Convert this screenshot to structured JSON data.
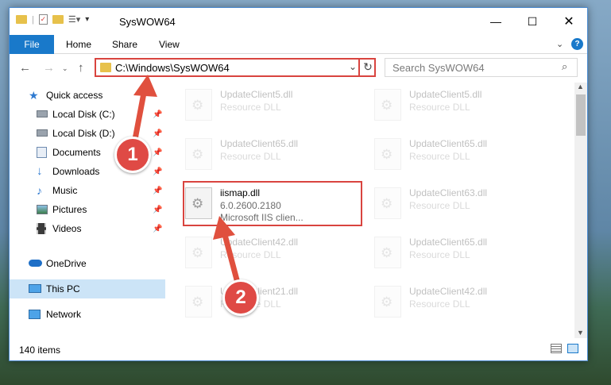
{
  "window": {
    "title": "SysWOW64"
  },
  "ribbon": {
    "tabs": [
      "File",
      "Home",
      "Share",
      "View"
    ]
  },
  "address": {
    "path": "C:\\Windows\\SysWOW64"
  },
  "search": {
    "placeholder": "Search SysWOW64"
  },
  "sidebar": {
    "items": [
      {
        "label": "Quick access",
        "icon": "star-icon",
        "pinned": false
      },
      {
        "label": "Local Disk (C:)",
        "icon": "drive-icon",
        "pinned": true
      },
      {
        "label": "Local Disk (D:)",
        "icon": "drive-icon",
        "pinned": true
      },
      {
        "label": "Documents",
        "icon": "documents-icon",
        "pinned": true
      },
      {
        "label": "Downloads",
        "icon": "download-icon",
        "pinned": true
      },
      {
        "label": "Music",
        "icon": "music-icon",
        "pinned": true
      },
      {
        "label": "Pictures",
        "icon": "pictures-icon",
        "pinned": true
      },
      {
        "label": "Videos",
        "icon": "videos-icon",
        "pinned": true
      },
      {
        "label": "OneDrive",
        "icon": "cloud-icon",
        "pinned": false
      },
      {
        "label": "This PC",
        "icon": "pc-icon",
        "pinned": false,
        "selected": true
      },
      {
        "label": "Network",
        "icon": "network-icon",
        "pinned": false
      }
    ]
  },
  "files": [
    {
      "name": "UpdateClient5.dll",
      "sub": "Resource DLL",
      "faded": true
    },
    {
      "name": "UpdateClient5.dll",
      "sub": "Resource DLL",
      "faded": true
    },
    {
      "name": "UpdateClient65.dll",
      "sub": "Resource DLL",
      "faded": true
    },
    {
      "name": "UpdateClient65.dll",
      "sub": "Resource DLL",
      "faded": true
    },
    {
      "name": "iismap.dll",
      "sub": "6.0.2600.2180",
      "desc": "Microsoft IIS clien...",
      "faded": false
    },
    {
      "name": "UpdateClient63.dll",
      "sub": "Resource DLL",
      "faded": true
    },
    {
      "name": "UpdateClient42.dll",
      "sub": "Resource DLL",
      "faded": true
    },
    {
      "name": "UpdateClient65.dll",
      "sub": "Resource DLL",
      "faded": true
    },
    {
      "name": "UpdateClient21.dll",
      "sub": "Resource DLL",
      "faded": true
    },
    {
      "name": "UpdateClient42.dll",
      "sub": "Resource DLL",
      "faded": true
    }
  ],
  "status": {
    "items": "140 items"
  },
  "annotations": {
    "step1": "1",
    "step2": "2"
  },
  "colors": {
    "accent": "#1979ca",
    "highlight": "#d9443f"
  }
}
